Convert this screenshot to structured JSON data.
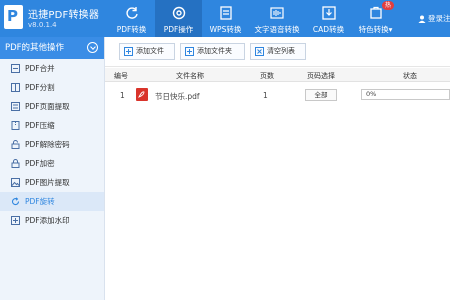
{
  "app": {
    "title": "迅捷PDF转换器",
    "version": "v8.0.1.4"
  },
  "nav": [
    {
      "label": "PDF转换",
      "icon": "refresh-icon",
      "active": false
    },
    {
      "label": "PDF操作",
      "icon": "gear-icon",
      "active": true
    },
    {
      "label": "WPS转换",
      "icon": "document-convert-icon",
      "active": false
    },
    {
      "label": "文字语音转换",
      "icon": "audio-wave-icon",
      "active": false
    },
    {
      "label": "CAD转换",
      "icon": "download-box-icon",
      "active": false
    },
    {
      "label": "特色转换▾",
      "icon": "feature-icon",
      "active": false,
      "badge": "热"
    }
  ],
  "login_label": "登录注",
  "sidebar": {
    "header": "PDF的其他操作",
    "items": [
      {
        "label": "PDF合并",
        "icon": "merge-icon"
      },
      {
        "label": "PDF分割",
        "icon": "split-icon"
      },
      {
        "label": "PDF页面提取",
        "icon": "extract-icon"
      },
      {
        "label": "PDF压缩",
        "icon": "compress-icon"
      },
      {
        "label": "PDF解除密码",
        "icon": "unlock-icon"
      },
      {
        "label": "PDF加密",
        "icon": "lock-icon"
      },
      {
        "label": "PDF图片提取",
        "icon": "image-icon"
      },
      {
        "label": "PDF旋转",
        "icon": "rotate-icon",
        "active": true
      },
      {
        "label": "PDF添加水印",
        "icon": "watermark-icon"
      }
    ]
  },
  "toolbar": {
    "add_file": "添加文件",
    "add_folder": "添加文件夹",
    "clear_list": "清空列表"
  },
  "table": {
    "headers": {
      "index": "编号",
      "name": "文件名称",
      "pages": "页数",
      "range": "页码选择",
      "status": "状态"
    },
    "rows": [
      {
        "index": "1",
        "name": "节日快乐.pdf",
        "pages": "1",
        "range": "全部",
        "progress_text": "0%",
        "progress": 0
      }
    ]
  },
  "colors": {
    "brand": "#2f86df",
    "nav_active": "#2571c2",
    "pdf_red": "#d9342b"
  }
}
